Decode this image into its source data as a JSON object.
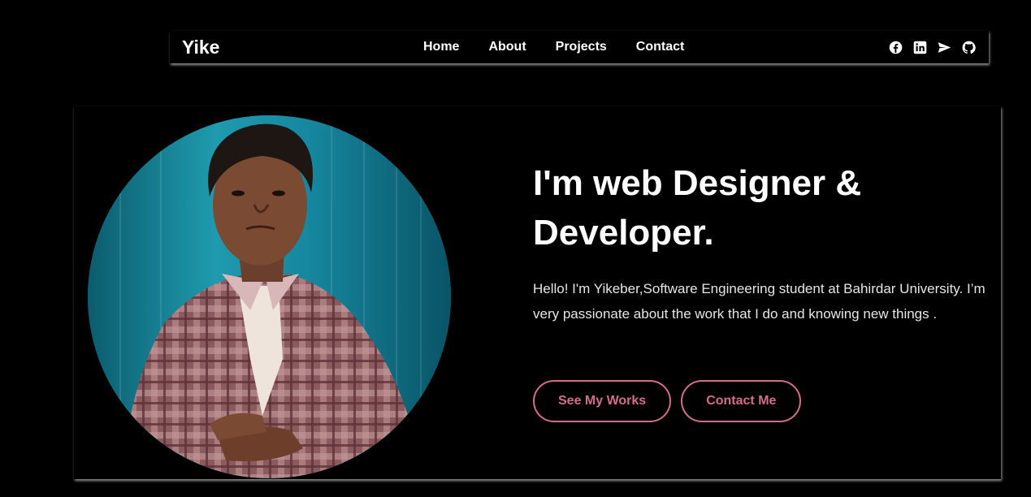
{
  "nav": {
    "brand": "Yike",
    "links": [
      "Home",
      "About",
      "Projects",
      "Contact"
    ],
    "socials": [
      "facebook-icon",
      "linkedin-icon",
      "telegram-icon",
      "github-icon"
    ]
  },
  "hero": {
    "title": "I'm web Designer & Developer.",
    "description": "Hello! I'm Yikeber,Software Engineering student at Bahirdar University. I’m very passionate about the work that I do and knowing new things .",
    "buttons": [
      "See My Works",
      "Contact Me"
    ],
    "photo_alt": "profile-photo"
  },
  "colors": {
    "background": "#000000",
    "accent": "#d26e8c",
    "text": "#ffffff",
    "photo_bg": "#14879a"
  }
}
